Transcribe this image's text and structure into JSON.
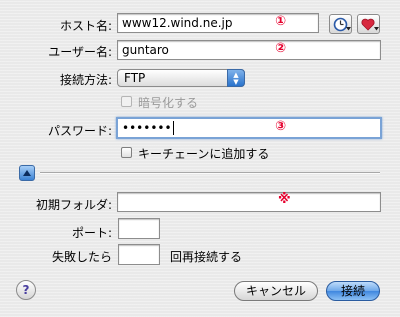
{
  "form": {
    "host_label": "ホスト名:",
    "host_value": "www12.wind.ne.jp",
    "user_label": "ユーザー名:",
    "user_value": "guntaro",
    "method_label": "接続方法:",
    "method_value": "FTP",
    "encrypt_label": "暗号化する",
    "password_label": "パスワード:",
    "password_value": "•••••••",
    "keychain_label": "キーチェーンに追加する",
    "folder_label": "初期フォルダ:",
    "folder_value": "",
    "port_label": "ポート:",
    "port_value": "",
    "retry_prefix": "失敗したら",
    "retry_value": "",
    "retry_suffix": "回再接続する"
  },
  "annotations": {
    "host_mark": "①",
    "user_mark": "②",
    "password_mark": "③",
    "folder_mark": "※"
  },
  "buttons": {
    "help": "?",
    "cancel": "キャンセル",
    "connect": "接続"
  },
  "icons": {
    "history": "clock-icon",
    "favorites": "heart-icon",
    "disclosure": "triangle-up-icon",
    "popup_arrow": "up-down-arrows-icon"
  },
  "colors": {
    "annotation": "#e6002d",
    "accent": "#3f87df",
    "focus_ring": "#7aa3d6"
  }
}
